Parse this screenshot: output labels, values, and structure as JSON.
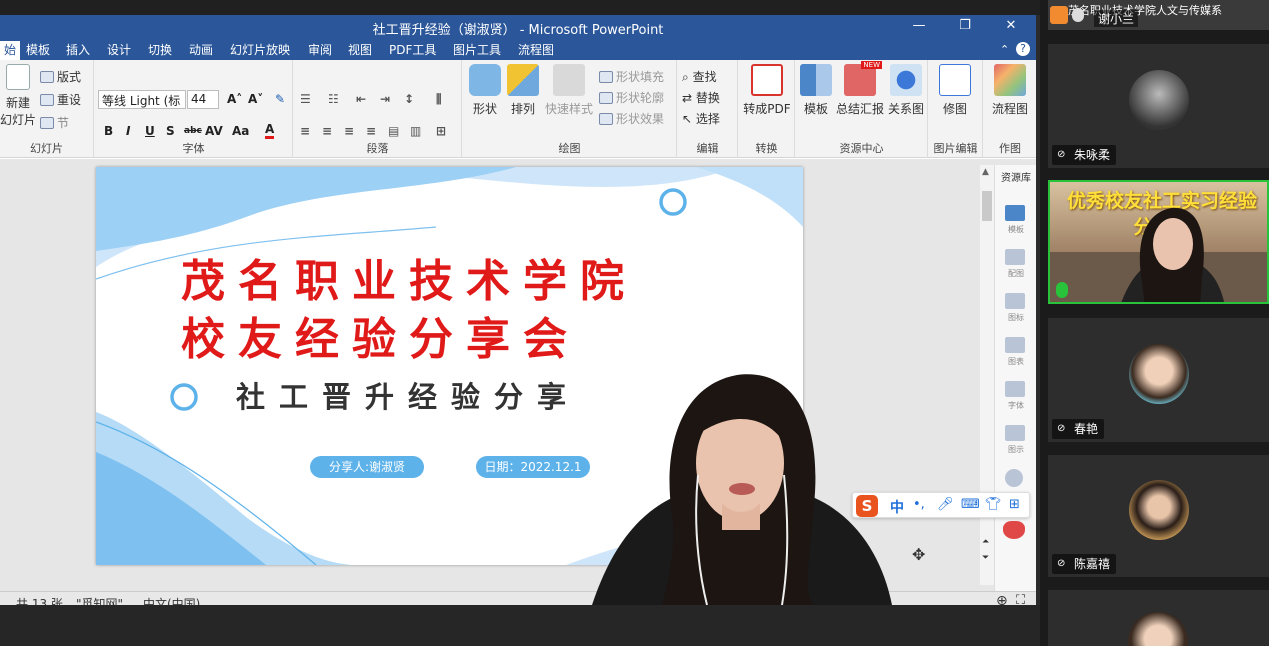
{
  "window": {
    "title": "社工晋升经验（谢淑贤） - Microsoft PowerPoint"
  },
  "menu": {
    "tabs": [
      "始",
      "模板",
      "插入",
      "设计",
      "切换",
      "动画",
      "幻灯片放映",
      "审阅",
      "视图",
      "PDF工具",
      "图片工具",
      "流程图"
    ]
  },
  "ribbon": {
    "slides_group": {
      "new_slide": "新建",
      "new_slide_sub": "幻灯片",
      "layout": "版式",
      "reset": "重设",
      "section": "节",
      "label": "幻灯片"
    },
    "font_group": {
      "font_name": "等线 Light (标",
      "font_size": "44",
      "label": "字体"
    },
    "paragraph_group": {
      "label": "段落"
    },
    "drawing_group": {
      "shape": "形状",
      "arrange": "排列",
      "quick_styles": "快速样式",
      "shape_fill": "形状填充",
      "shape_outline": "形状轮廓",
      "shape_effects": "形状效果",
      "label": "绘图"
    },
    "edit_group": {
      "find": "查找",
      "replace": "替换",
      "select": "选择",
      "label": "编辑"
    },
    "convert_group": {
      "to_pdf": "转成PDF",
      "label": "转换"
    },
    "resource_group": {
      "template": "模板",
      "summary": "总结汇报",
      "relation": "关系图",
      "new_badge": "NEW",
      "label": "资源中心"
    },
    "image_group": {
      "crop": "修图",
      "label": "图片编辑"
    },
    "diagram_group": {
      "flowchart": "流程图",
      "label": "作图"
    }
  },
  "side_panel": {
    "resource_lib": "资源库",
    "items": [
      "模板",
      "配图",
      "图标",
      "图表",
      "字体",
      "图示"
    ]
  },
  "slide": {
    "title_line1": "茂名职业技术学院",
    "title_line2": "校友经验分享会",
    "subtitle": "社工晋升经验分享",
    "presenter": "分享人:谢淑贤",
    "date": "日期：2022.12.1"
  },
  "statusbar": {
    "slide_count": "，共 13 张",
    "theme": "\"觅知网\"",
    "language": "中文(中国)"
  },
  "ime": {
    "logo": "S",
    "mode": "中"
  },
  "participants": [
    {
      "name": "谢小兰",
      "banner": "茂名职业技术学院人文与传媒系"
    },
    {
      "name": "朱咏柔"
    },
    {
      "name": "",
      "banner": "优秀校友社工实习经验分享会",
      "active": true
    },
    {
      "name": "春艳"
    },
    {
      "name": "陈嘉禧"
    },
    {
      "name": ""
    }
  ],
  "colors": {
    "title_bar": "#2b579a",
    "slide_title": "#e01919",
    "slide_pill": "#5db2ea",
    "active_speaker": "#29c23b"
  }
}
